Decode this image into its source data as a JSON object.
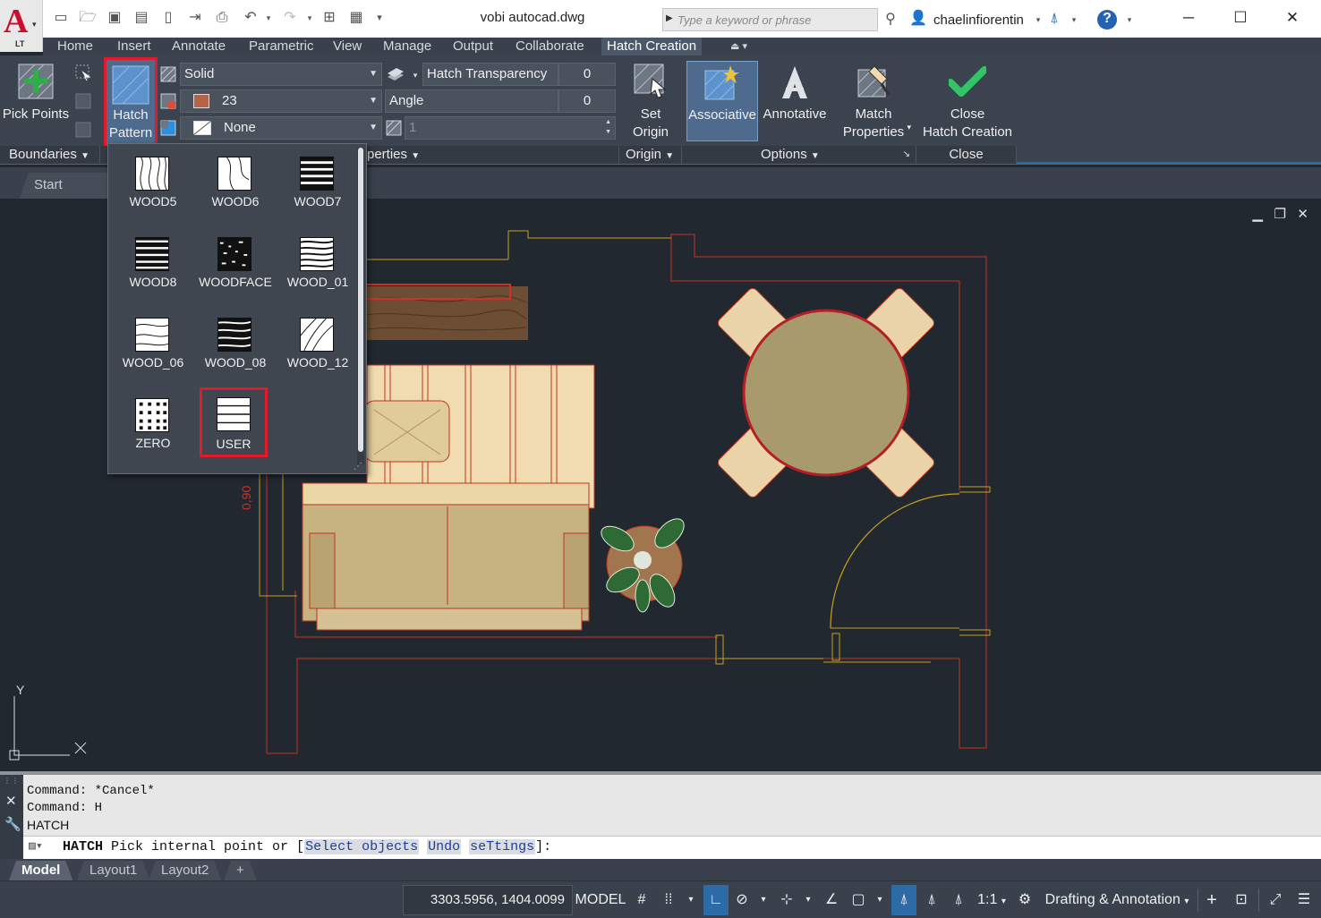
{
  "title_bar": {
    "app_logo": "A",
    "app_edition": "LT",
    "document_title": "vobi autocad.dwg",
    "search_placeholder": "Type a keyword or phrase",
    "user_name": "chaelinfiorentin",
    "help": "?"
  },
  "ribbon_tabs": [
    "Home",
    "Insert",
    "Annotate",
    "Parametric",
    "View",
    "Manage",
    "Output",
    "Collaborate",
    "Hatch Creation"
  ],
  "active_tab": "Hatch Creation",
  "ribbon": {
    "pick_points": "Pick Points",
    "hatch_pattern_line1": "Hatch",
    "hatch_pattern_line2": "Pattern",
    "pattern_type": "Solid",
    "color_value": "23",
    "color_swatch": "#b5634b",
    "background_value": "None",
    "transparency_label": "Hatch Transparency",
    "transparency_value": "0",
    "angle_label": "Angle",
    "angle_value": "0",
    "scale_value": "1",
    "set_origin_line1": "Set",
    "set_origin_line2": "Origin",
    "associative": "Associative",
    "annotative": "Annotative",
    "match_line1": "Match",
    "match_line2": "Properties",
    "close_line1": "Close",
    "close_line2": "Hatch Creation",
    "panels": {
      "boundaries": "Boundaries",
      "properties": "perties",
      "origin": "Origin",
      "options": "Options",
      "close": "Close"
    }
  },
  "file_tab": "Start",
  "gallery": {
    "items": [
      {
        "name": "WOOD5"
      },
      {
        "name": "WOOD6"
      },
      {
        "name": "WOOD7"
      },
      {
        "name": "WOOD8"
      },
      {
        "name": "WOODFACE"
      },
      {
        "name": "WOOD_01"
      },
      {
        "name": "WOOD_06"
      },
      {
        "name": "WOOD_08"
      },
      {
        "name": "WOOD_12"
      },
      {
        "name": "ZERO"
      },
      {
        "name": "USER"
      }
    ],
    "highlighted": "USER"
  },
  "drawing": {
    "dimension_text": "0,90",
    "ucs_y": "Y",
    "ucs_x": "X"
  },
  "command": {
    "history": [
      "Command: *Cancel*",
      "Command: H",
      "HATCH"
    ],
    "prompt_command": "HATCH",
    "prompt_text": " Pick internal point or [",
    "options": [
      "Select objects",
      "Undo",
      "seTtings"
    ],
    "prompt_end": "]:"
  },
  "layout_tabs": [
    "Model",
    "Layout1",
    "Layout2"
  ],
  "active_layout": "Model",
  "status_bar": {
    "coordinates": "3303.5956, 1404.0099",
    "space": "MODEL",
    "scale": "1:1",
    "workspace": "Drafting & Annotation"
  },
  "colors": {
    "accent_blue": "#2d6ba6",
    "highlight_red": "#e3192c",
    "ribbon_bg": "#3b434e",
    "canvas_bg": "#212830"
  }
}
